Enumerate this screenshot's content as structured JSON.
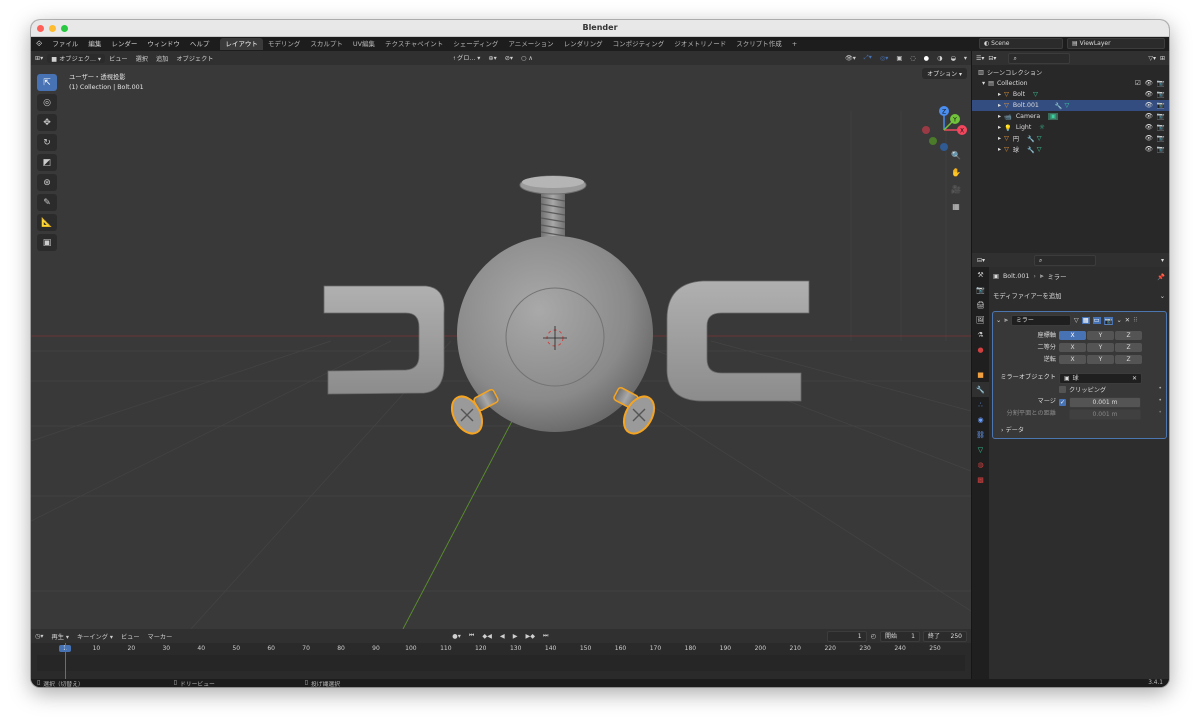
{
  "window": {
    "title": "Blender",
    "version": "3.4.1"
  },
  "menubar": {
    "menus": [
      "ファイル",
      "編集",
      "レンダー",
      "ウィンドウ",
      "ヘルプ"
    ],
    "workspaces": [
      "レイアウト",
      "モデリング",
      "スカルプト",
      "UV編集",
      "テクスチャペイント",
      "シェーディング",
      "アニメーション",
      "レンダリング",
      "コンポジティング",
      "ジオメトリノード",
      "スクリプト作成"
    ],
    "add_tab": "+",
    "scene": "Scene",
    "view_layer": "ViewLayer"
  },
  "viewport": {
    "header": {
      "mode": "オブジェク...",
      "view": "ビュー",
      "select": "選択",
      "add": "追加",
      "object": "オブジェクト",
      "transform": "グロ...",
      "options": "オプション"
    },
    "info_line1": "ユーザー・透視投影",
    "info_line2": "(1) Collection | Bolt.001",
    "gizmo": {
      "z": "Z",
      "y": "Y",
      "x": "X"
    }
  },
  "timeline": {
    "playback": "再生",
    "keying": "キーイング",
    "view": "ビュー",
    "marker": "マーカー",
    "current_frame": "1",
    "start_label": "開始",
    "start": "1",
    "end_label": "終了",
    "end": "250",
    "ticks": [
      "1",
      "10",
      "20",
      "30",
      "40",
      "50",
      "60",
      "70",
      "80",
      "90",
      "100",
      "110",
      "120",
      "130",
      "140",
      "150",
      "160",
      "170",
      "180",
      "190",
      "200",
      "210",
      "220",
      "230",
      "240",
      "250"
    ]
  },
  "statusbar": {
    "left": "選択（切替え）",
    "middle": "ドリービュー",
    "right": "投げ縄選択",
    "version": "3.4.1"
  },
  "outliner": {
    "root": "シーンコレクション",
    "collection": "Collection",
    "items": [
      {
        "name": "Bolt",
        "selected": false
      },
      {
        "name": "Bolt.001",
        "selected": true
      },
      {
        "name": "Camera",
        "selected": false
      },
      {
        "name": "Light",
        "selected": false
      },
      {
        "name": "円",
        "selected": false
      },
      {
        "name": "球",
        "selected": false
      }
    ]
  },
  "properties": {
    "breadcrumb_object": "Bolt.001",
    "breadcrumb_modifier": "ミラー",
    "add_modifier": "モディファイアーを追加",
    "modifier_name": "ミラー",
    "axis_label": "座標軸",
    "bisect_label": "二等分",
    "flip_label": "逆転",
    "x": "X",
    "y": "Y",
    "z": "Z",
    "mirror_object_label": "ミラーオブジェクト",
    "mirror_object_value": "球",
    "clipping_label": "クリッピング",
    "merge_label": "マージ",
    "merge_value": "0.001 m",
    "bisect_distance_label": "分割平面との距離",
    "bisect_distance_value": "0.001 m",
    "data_label": "データ"
  },
  "colors": {
    "accent": "#4772b3",
    "selection": "#f5a422",
    "viewport_bg": "#393939",
    "x_axis": "#f3475e",
    "y_axis": "#70c33a",
    "z_axis": "#4a8ef0"
  }
}
